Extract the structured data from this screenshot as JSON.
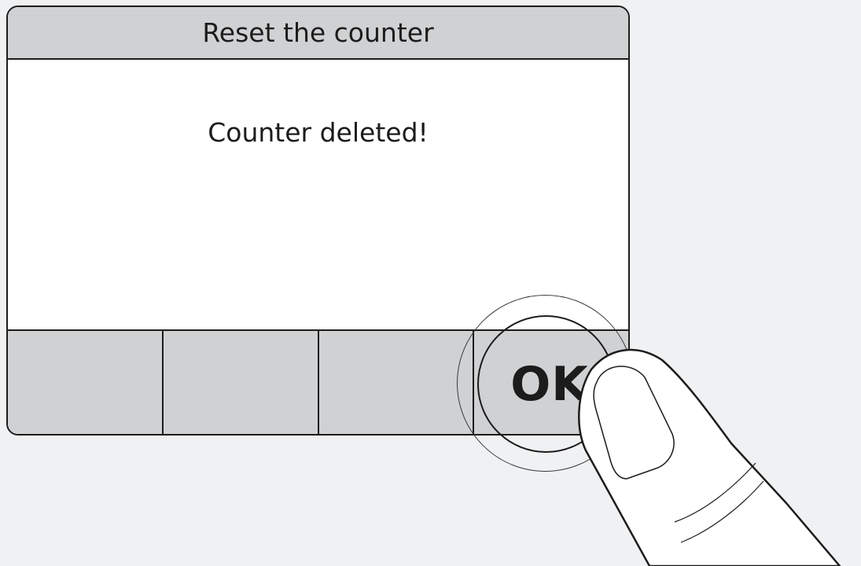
{
  "dialog": {
    "title": "Reset the counter",
    "message": "Counter deleted!"
  },
  "softkeys": [
    {
      "label": ""
    },
    {
      "label": ""
    },
    {
      "label": ""
    },
    {
      "label": "OK"
    }
  ],
  "colors": {
    "background": "#f0f1f3",
    "screen": "#ffffff",
    "bar": "#d0d1d3",
    "outline": "#1c1c1c"
  },
  "icons": {
    "press_indicator": "press-ring-icon",
    "finger": "finger-icon"
  }
}
